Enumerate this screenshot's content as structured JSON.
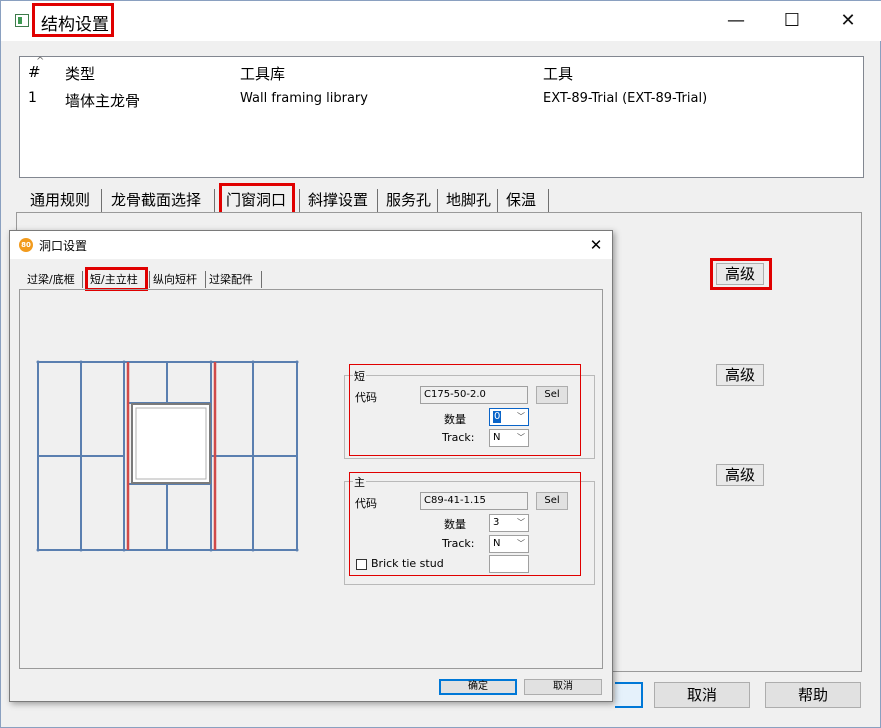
{
  "window": {
    "title": "结构设置",
    "minimize": "—",
    "maximize": "☐",
    "close": "✕"
  },
  "list": {
    "sort_caret": "^",
    "headers": [
      "#",
      "类型",
      "工具库",
      "工具"
    ],
    "rows": [
      [
        "1",
        "墙体主龙骨",
        "Wall framing library",
        "EXT-89-Trial (EXT-89-Trial)"
      ]
    ]
  },
  "tabs": [
    "通用规则",
    "龙骨截面选择",
    "门窗洞口",
    "斜撑设置",
    "服务孔",
    "地脚孔",
    "保温"
  ],
  "advanced_buttons": [
    "高级",
    "高级",
    "高级"
  ],
  "bottom_buttons": {
    "cancel": "取消",
    "help": "帮助"
  },
  "dialog": {
    "icon": "80",
    "title": "洞口设置",
    "close": "✕",
    "tabs": [
      "过梁/底框",
      "短/主立柱",
      "纵向短杆",
      "过梁配件"
    ],
    "short_group": {
      "legend": "短",
      "code_label": "代码",
      "code_value": "C175-50-2.0",
      "sel_label": "Sel",
      "qty_label": "数量",
      "qty_value": "0",
      "track_label": "Track:",
      "track_value": "N"
    },
    "main_group": {
      "legend": "主",
      "code_label": "代码",
      "code_value": "C89-41-1.15",
      "sel_label": "Sel",
      "qty_label": "数量",
      "qty_value": "3",
      "track_label": "Track:",
      "track_value": "N",
      "brick_label": "Brick tie stud"
    },
    "ok": "确定",
    "cancel": "取消"
  },
  "colors": {
    "highlight_red": "#e00000",
    "stud_blue": "#5a7fb0",
    "stud_red": "#d04a4a",
    "select_blue": "#0a64c8"
  }
}
